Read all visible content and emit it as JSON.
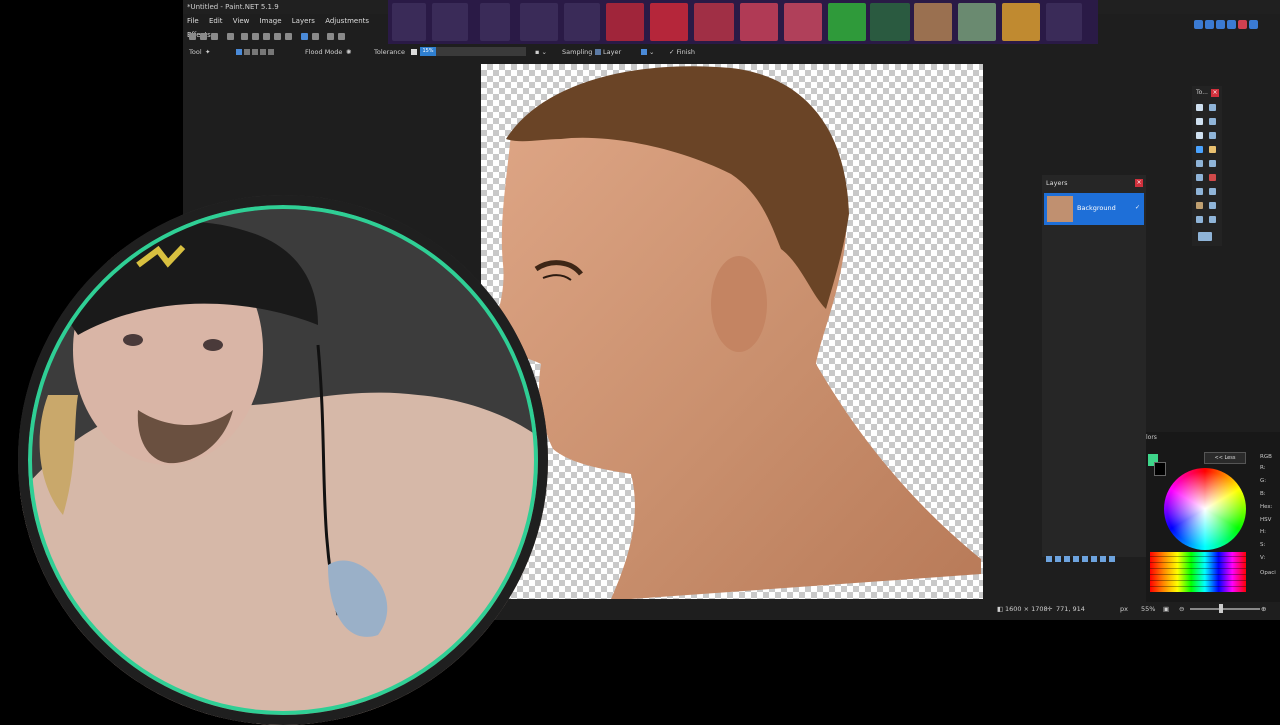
{
  "app": {
    "title": "*Untitled - Paint.NET 5.1.9"
  },
  "menu": [
    "File",
    "Edit",
    "View",
    "Image",
    "Layers",
    "Adjustments",
    "Effects"
  ],
  "options_bar": {
    "tool_label": "Tool",
    "flood_mode_label": "Flood Mode",
    "tolerance_label": "Tolerance",
    "tolerance_value": "15%",
    "sampling_label": "Sampling",
    "sampling_value": "Layer",
    "finish_label": "Finish"
  },
  "thumbnail_count": 17,
  "tools_window": {
    "title": "To..."
  },
  "layers_window": {
    "title": "Layers",
    "layers": [
      {
        "name": "Background",
        "visible": true,
        "selected": true
      }
    ]
  },
  "colors_window": {
    "title": "lors",
    "less_button": "<< Less",
    "labels": [
      "RGB",
      "R:",
      "G:",
      "B:",
      "Hex:",
      "HSV",
      "H:",
      "S:",
      "V:",
      "Opaci"
    ],
    "primary_color": "#3ed58a",
    "secondary_color": "#000000"
  },
  "status_bar": {
    "image_size": "1600 × 1708",
    "cursor_pos": "771, 914",
    "units": "px",
    "zoom": "55%"
  },
  "colors": {
    "accent": "#1e6fd8",
    "webcam_ring": "#2fcf95"
  },
  "icons": {
    "close": "×",
    "check": "✓"
  }
}
